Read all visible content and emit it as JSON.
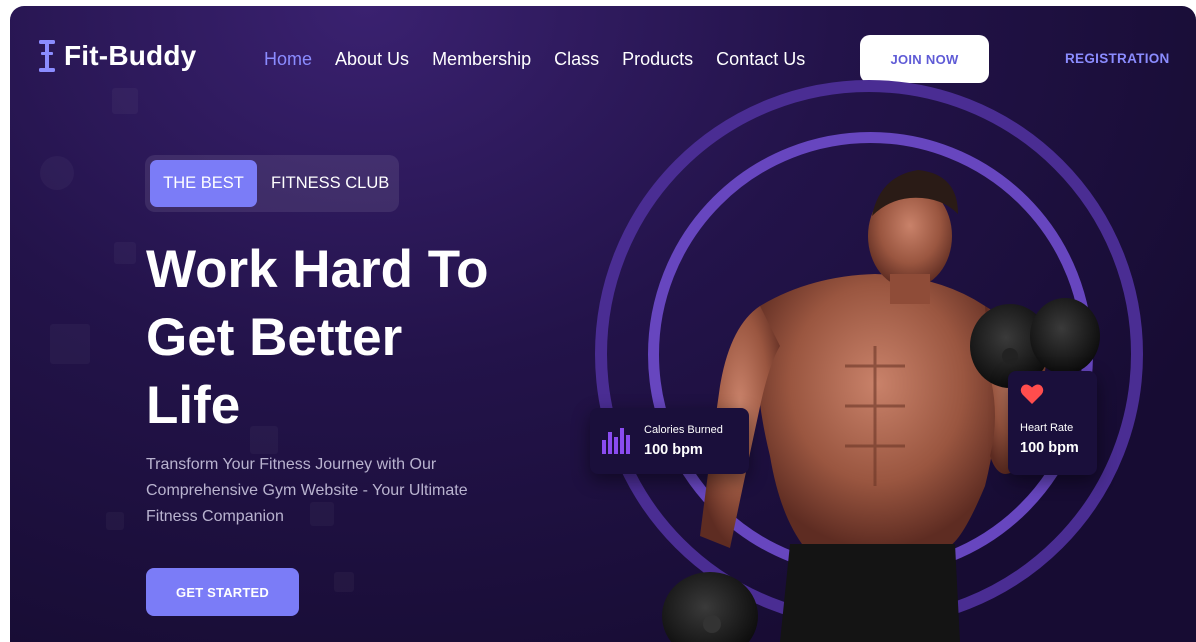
{
  "brand": {
    "name": "Fit-Buddy",
    "icon": "dumbbell-icon"
  },
  "nav": {
    "items": [
      {
        "label": "Home",
        "active": true
      },
      {
        "label": "About Us",
        "active": false
      },
      {
        "label": "Membership",
        "active": false
      },
      {
        "label": "Class",
        "active": false
      },
      {
        "label": "Products",
        "active": false
      },
      {
        "label": "Contact Us",
        "active": false
      }
    ],
    "join_label": "JOIN NOW",
    "registration_label": "REGISTRATION"
  },
  "hero": {
    "badge_highlight": "THE BEST",
    "badge_text": "FITNESS CLUB",
    "headline_lines": [
      "Work Hard To",
      "Get Better",
      "Life"
    ],
    "description": "Transform Your Fitness Journey with Our Comprehensive Gym Website - Your Ultimate Fitness Companion",
    "cta_label": "GET STARTED"
  },
  "stats": {
    "calories": {
      "label": "Calories Burned",
      "value": "100 bpm",
      "icon": "bar-chart-icon"
    },
    "heart_rate": {
      "label": "Heart Rate",
      "value": "100 bpm",
      "icon": "heart-icon"
    }
  },
  "colors": {
    "accent": "#7b7cf7",
    "active_nav": "#8b8cff",
    "background": "#1d1040",
    "heart": "#ff4d4d"
  }
}
